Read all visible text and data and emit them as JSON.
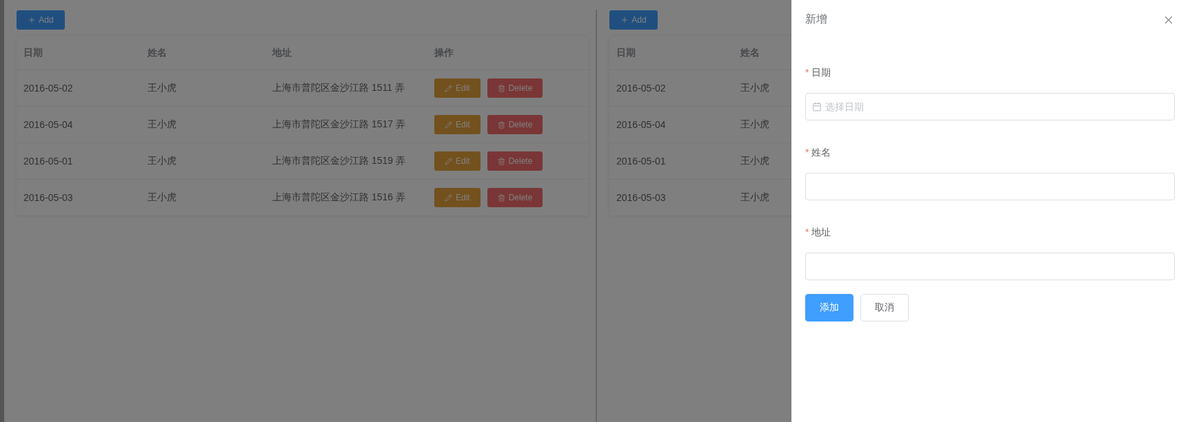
{
  "left_panel": {
    "add_button": {
      "label": "Add"
    },
    "table": {
      "columns": [
        "日期",
        "姓名",
        "地址",
        "操作"
      ],
      "rows": [
        {
          "date": "2016-05-02",
          "name": "王小虎",
          "address": "上海市普陀区金沙江路 1511 弄",
          "actions": [
            {
              "kind": "edit",
              "label": "Edit"
            },
            {
              "kind": "delete",
              "label": "Delete"
            }
          ]
        },
        {
          "date": "2016-05-04",
          "name": "王小虎",
          "address": "上海市普陀区金沙江路 1517 弄",
          "actions": [
            {
              "kind": "edit",
              "label": "Edit"
            },
            {
              "kind": "delete",
              "label": "Delete"
            }
          ]
        },
        {
          "date": "2016-05-01",
          "name": "王小虎",
          "address": "上海市普陀区金沙江路 1519 弄",
          "actions": [
            {
              "kind": "edit",
              "label": "Edit"
            },
            {
              "kind": "delete",
              "label": "Delete"
            }
          ]
        },
        {
          "date": "2016-05-03",
          "name": "王小虎",
          "address": "上海市普陀区金沙江路 1516 弄",
          "actions": [
            {
              "kind": "edit",
              "label": "Edit"
            },
            {
              "kind": "delete",
              "label": "Delete"
            }
          ]
        }
      ]
    }
  },
  "right_panel": {
    "add_button": {
      "label": "Add"
    },
    "table": {
      "columns": [
        "日期",
        "姓名"
      ],
      "rows": [
        {
          "date": "2016-05-02",
          "name": "王小虎"
        },
        {
          "date": "2016-05-04",
          "name": "王小虎"
        },
        {
          "date": "2016-05-01",
          "name": "王小虎"
        },
        {
          "date": "2016-05-03",
          "name": "王小虎"
        }
      ]
    }
  },
  "drawer": {
    "title": "新增",
    "fields": [
      {
        "required_mark": "*",
        "label": "日期",
        "kind": "date",
        "placeholder": "选择日期"
      },
      {
        "required_mark": "*",
        "label": "姓名",
        "kind": "text"
      },
      {
        "required_mark": "*",
        "label": "地址",
        "kind": "text"
      }
    ],
    "buttons": [
      {
        "kind": "primary",
        "label": "添加"
      },
      {
        "kind": "default",
        "label": "取消"
      }
    ]
  }
}
